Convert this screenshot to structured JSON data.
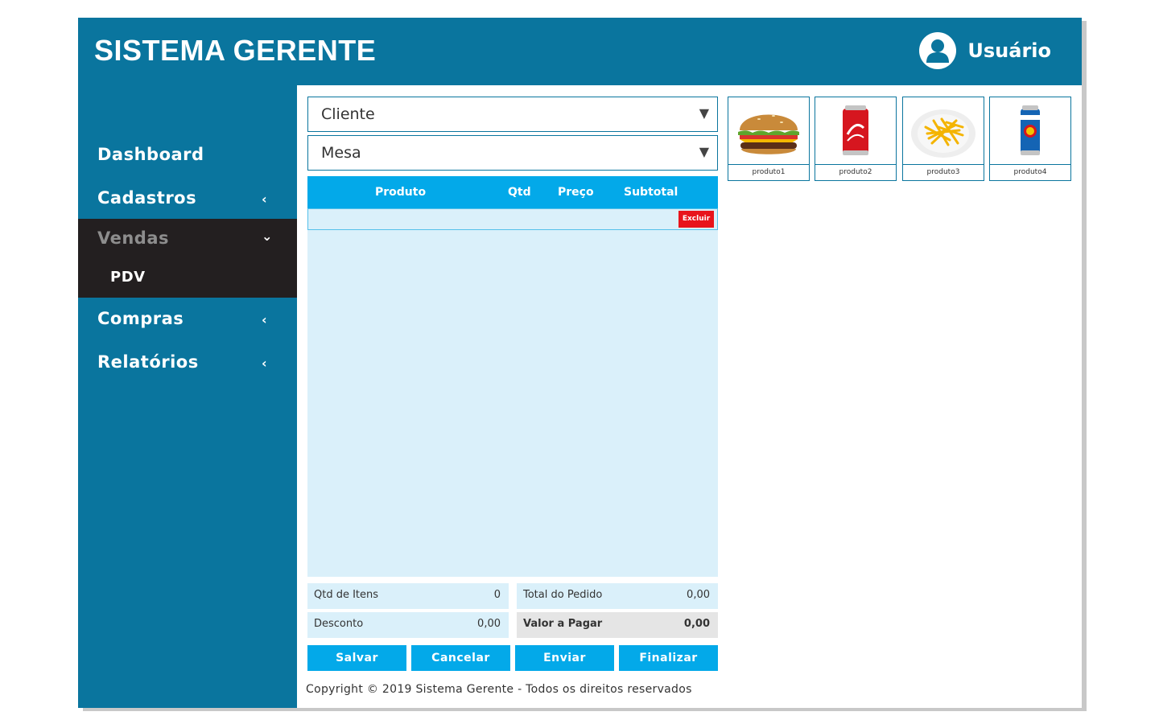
{
  "header": {
    "title": "SISTEMA GERENTE",
    "user_name": "Usuário",
    "user_icon": "user-avatar-icon"
  },
  "sidebar": {
    "items": [
      {
        "label": "Dashboard",
        "chevron": ""
      },
      {
        "label": "Cadastros",
        "chevron": "‹"
      },
      {
        "label": "Vendas",
        "chevron": "⌄",
        "expanded": true,
        "children": [
          {
            "label": "PDV"
          }
        ]
      },
      {
        "label": "Compras",
        "chevron": "‹"
      },
      {
        "label": "Relatórios",
        "chevron": "‹"
      }
    ]
  },
  "form": {
    "cliente_select": "Cliente",
    "mesa_select": "Mesa"
  },
  "table": {
    "columns": [
      "Produto",
      "Qtd",
      "Preço",
      "Subtotal"
    ],
    "row_action": "Excluir"
  },
  "summary": {
    "qtd_itens_label": "Qtd de Itens",
    "qtd_itens_value": "0",
    "desconto_label": "Desconto",
    "desconto_value": "0,00",
    "total_pedido_label": "Total do Pedido",
    "total_pedido_value": "0,00",
    "valor_pagar_label": "Valor a Pagar",
    "valor_pagar_value": "0,00"
  },
  "actions": {
    "salvar": "Salvar",
    "cancelar": "Cancelar",
    "enviar": "Enviar",
    "finalizar": "Finalizar"
  },
  "products": [
    {
      "label": "produto1",
      "icon": "burger-image"
    },
    {
      "label": "produto2",
      "icon": "coca-cola-can-image"
    },
    {
      "label": "produto3",
      "icon": "french-fries-image"
    },
    {
      "label": "produto4",
      "icon": "beer-can-image"
    }
  ],
  "footer": {
    "copyright": "Copyright © 2019 Sistema Gerente - Todos os direitos reservados"
  },
  "colors": {
    "primary": "#0a759e",
    "accent": "#03a9e9",
    "sidebar_active": "#231f20",
    "danger": "#e8141c",
    "table_bg": "#daf0fa"
  }
}
